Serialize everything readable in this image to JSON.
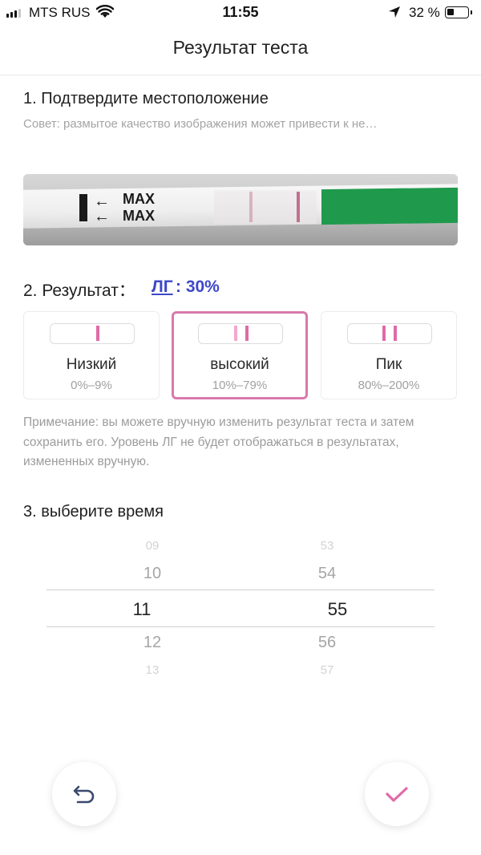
{
  "status_bar": {
    "carrier": "MTS RUS",
    "time": "11:55",
    "battery_percent": "32 %",
    "battery_level": 0.32,
    "icons": [
      "signal-icon",
      "wifi-icon",
      "location-arrow-icon",
      "battery-icon"
    ]
  },
  "nav": {
    "title": "Результат теста"
  },
  "step1": {
    "title": "1. Подтвердите местоположение",
    "hint": "Совет: размытое качество изображения может привести к не…",
    "photo": {
      "arrow_1": "←",
      "arrow_2": "←",
      "max_1": "MAX",
      "max_2": "MAX"
    }
  },
  "step2": {
    "label": "2. Результат：",
    "hormone": "ЛГ",
    "value": ": 30%",
    "levels": [
      {
        "name": "Низкий",
        "range": "0%–9%",
        "selected": false
      },
      {
        "name": "высокий",
        "range": "10%–79%",
        "selected": true
      },
      {
        "name": "Пик",
        "range": "80%–200%",
        "selected": false
      }
    ],
    "note": "Примечание: вы можете вручную изменить результат теста и затем сохранить его. Уровень ЛГ не будет отображаться в результатах, измененных вручную."
  },
  "step3": {
    "title": "3. выберите время",
    "hours": [
      "09",
      "10",
      "11",
      "12",
      "13"
    ],
    "minutes": [
      "53",
      "54",
      "55",
      "56",
      "57"
    ],
    "selected_hour": "11",
    "selected_minute": "55"
  },
  "colors": {
    "accent_pink": "#d979ac",
    "link_blue": "#3d48c9",
    "undo_icon": "#3a4a6e",
    "confirm_icon": "#e06aa7"
  },
  "buttons": {
    "undo_icon": "undo-icon",
    "confirm_icon": "checkmark-icon"
  }
}
